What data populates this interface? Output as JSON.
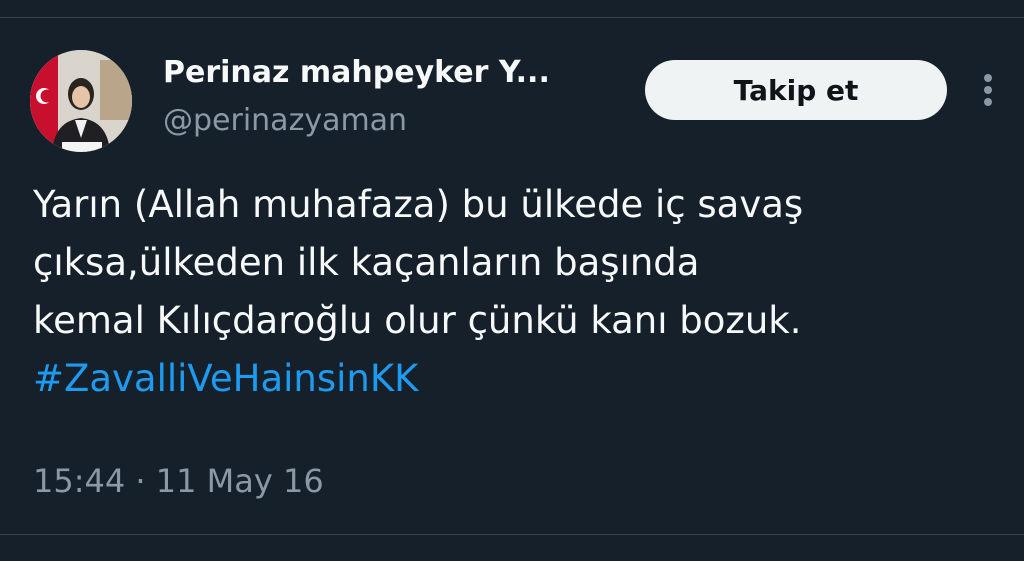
{
  "author": {
    "display_name": "Perinaz mahpeyker Y...",
    "handle": "@perinazyaman"
  },
  "follow_button": {
    "label": "Takip et"
  },
  "tweet": {
    "lines": [
      "Yarın (Allah muhafaza) bu ülkede iç savaş",
      "çıksa,ülkeden ilk kaçanların başında",
      "kemal Kılıçdaroğlu olur çünkü kanı bozuk."
    ],
    "hashtag": "#ZavalliVeHainsinKK"
  },
  "timestamp": "15:44 · 11 May 16",
  "colors": {
    "background": "#15202b",
    "hashtag": "#1d9bf0",
    "secondary_text": "#8b98a5"
  },
  "icons": {
    "more": "more-vertical-icon"
  }
}
